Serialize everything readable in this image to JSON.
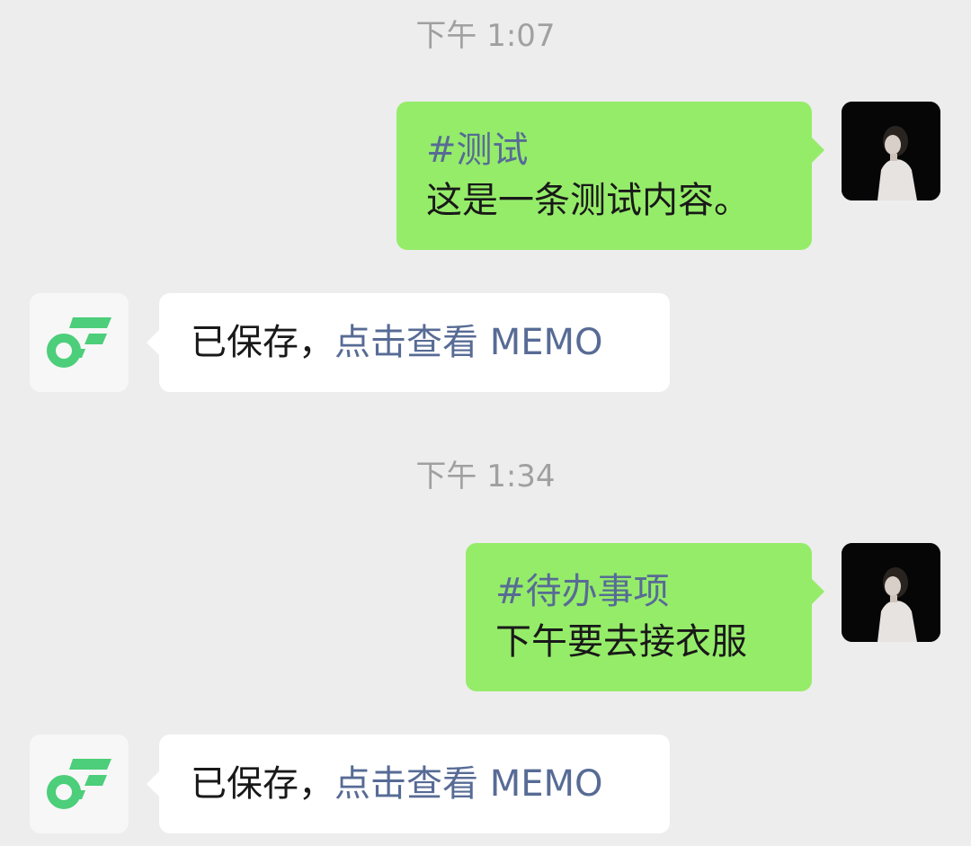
{
  "colors": {
    "background": "#ededed",
    "sent_bubble": "#95ec69",
    "received_bubble": "#ffffff",
    "link": "#576b95",
    "timestamp": "#a0a0a0",
    "bot_logo": "#4cce7a"
  },
  "messages": [
    {
      "timestamp": "下午 1:07",
      "sent": {
        "tag": "#测试",
        "content": "这是一条测试内容。",
        "avatar": "user-avatar-photo"
      },
      "reply": {
        "prefix": "已保存，",
        "link_text": "点击查看 MEMO",
        "avatar": "memo-logo-icon"
      }
    },
    {
      "timestamp": "下午 1:34",
      "sent": {
        "tag": "#待办事项",
        "content": "下午要去接衣服",
        "avatar": "user-avatar-photo"
      },
      "reply": {
        "prefix": "已保存，",
        "link_text": "点击查看 MEMO",
        "avatar": "memo-logo-icon"
      }
    }
  ]
}
